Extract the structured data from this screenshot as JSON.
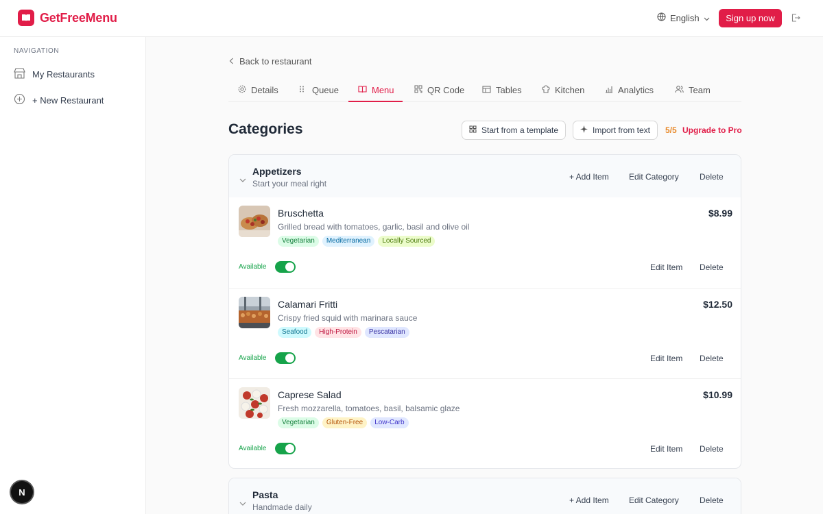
{
  "header": {
    "brand": "GetFreeMenu",
    "language": "English",
    "signup_label": "Sign up now"
  },
  "sidebar": {
    "heading": "NAVIGATION",
    "items": [
      {
        "label": "My Restaurants",
        "icon": "store-icon"
      },
      {
        "label": "+ New Restaurant",
        "icon": "plus-circle-icon"
      }
    ],
    "fab_label": "N"
  },
  "main": {
    "back_label": "Back to restaurant",
    "tabs": [
      {
        "label": "Details",
        "icon": "gear-icon"
      },
      {
        "label": "Queue",
        "icon": "list-icon"
      },
      {
        "label": "Menu",
        "icon": "book-icon",
        "active": true
      },
      {
        "label": "QR Code",
        "icon": "qr-icon"
      },
      {
        "label": "Tables",
        "icon": "table-icon"
      },
      {
        "label": "Kitchen",
        "icon": "chef-icon"
      },
      {
        "label": "Analytics",
        "icon": "bar-chart-icon"
      },
      {
        "label": "Team",
        "icon": "users-icon"
      }
    ],
    "title": "Categories",
    "template_button": "Start from a template",
    "import_button": "Import from text",
    "quota": "5/5",
    "upgrade_label": "Upgrade to Pro"
  },
  "categories": [
    {
      "name": "Appetizers",
      "description": "Start your meal right",
      "add_item_label": "+ Add Item",
      "edit_label": "Edit Category",
      "delete_label": "Delete",
      "items": [
        {
          "name": "Bruschetta",
          "description": "Grilled bread with tomatoes, garlic, basil and olive oil",
          "price": "$8.99",
          "tags": [
            {
              "label": "Vegetarian",
              "bg": "#dcfce7",
              "fg": "#15803d"
            },
            {
              "label": "Mediterranean",
              "bg": "#e0f2fe",
              "fg": "#0369a1"
            },
            {
              "label": "Locally Sourced",
              "bg": "#ecfccb",
              "fg": "#4d7c0f"
            }
          ],
          "status": "Available",
          "edit_label": "Edit Item",
          "delete_label": "Delete"
        },
        {
          "name": "Calamari Fritti",
          "description": "Crispy fried squid with marinara sauce",
          "price": "$12.50",
          "tags": [
            {
              "label": "Seafood",
              "bg": "#cffafe",
              "fg": "#0e7490"
            },
            {
              "label": "High-Protein",
              "bg": "#ffe4e6",
              "fg": "#be123c"
            },
            {
              "label": "Pescatarian",
              "bg": "#e0e7ff",
              "fg": "#3730a3"
            }
          ],
          "status": "Available",
          "edit_label": "Edit Item",
          "delete_label": "Delete"
        },
        {
          "name": "Caprese Salad",
          "description": "Fresh mozzarella, tomatoes, basil, balsamic glaze",
          "price": "$10.99",
          "tags": [
            {
              "label": "Vegetarian",
              "bg": "#dcfce7",
              "fg": "#15803d"
            },
            {
              "label": "Gluten-Free",
              "bg": "#fef3c7",
              "fg": "#b45309"
            },
            {
              "label": "Low-Carb",
              "bg": "#e0e7ff",
              "fg": "#4338ca"
            }
          ],
          "status": "Available",
          "edit_label": "Edit Item",
          "delete_label": "Delete"
        }
      ]
    },
    {
      "name": "Pasta",
      "description": "Handmade daily",
      "add_item_label": "+ Add Item",
      "edit_label": "Edit Category",
      "delete_label": "Delete",
      "items": []
    }
  ],
  "colors": {
    "brand": "#e11d48",
    "available": "#16a34a",
    "quota": "#e88a2b"
  }
}
